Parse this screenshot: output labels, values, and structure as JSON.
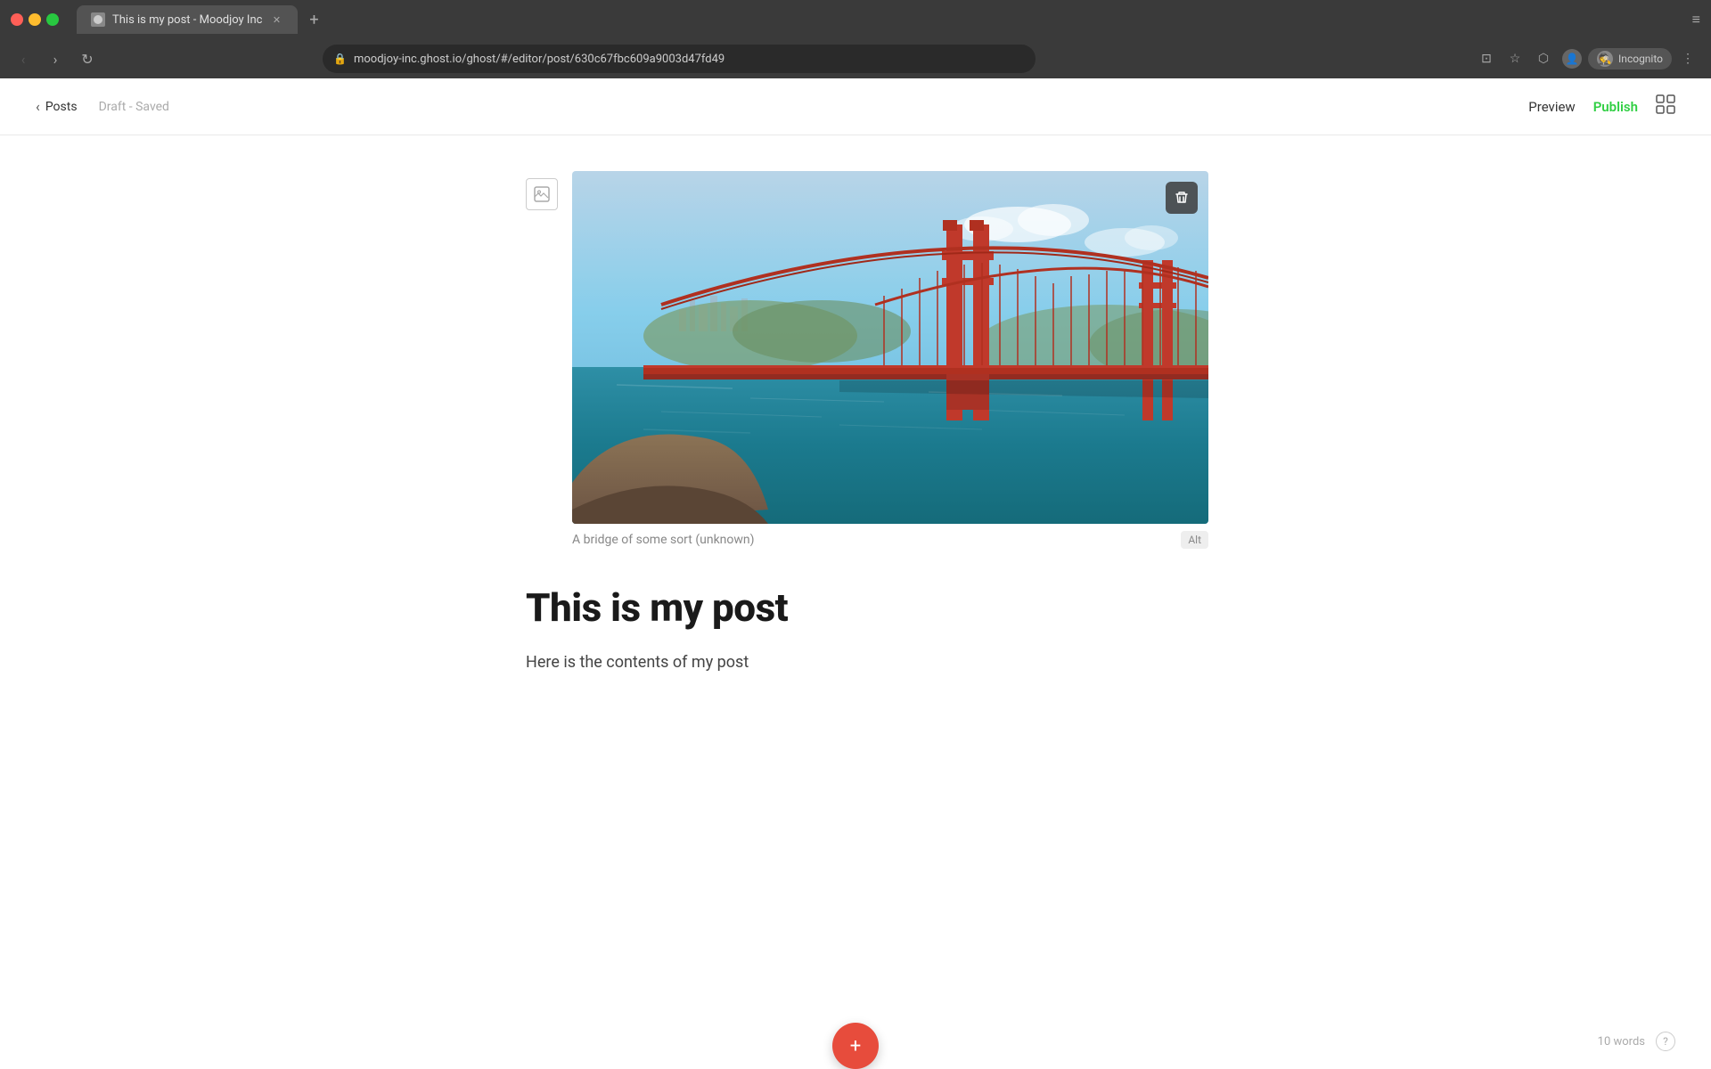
{
  "browser": {
    "tab_title": "This is my post - Moodjoy Inc",
    "url": "moodjoy-inc.ghost.io/ghost/#/editor/post/630c67fbc609a9003d47fd49",
    "incognito_label": "Incognito",
    "new_tab_label": "+",
    "tab_end_label": "≡"
  },
  "toolbar": {
    "back_label": "Posts",
    "draft_status": "Draft - Saved",
    "preview_label": "Preview",
    "publish_label": "Publish"
  },
  "post": {
    "image_caption": "A bridge of some sort (unknown)",
    "alt_badge": "Alt",
    "title": "This is my post",
    "body": "Here is the contents of my post"
  },
  "footer": {
    "word_count": "10 words",
    "help_label": "?"
  },
  "icons": {
    "back_arrow": "‹",
    "image_icon": "🖼",
    "delete_icon": "🗑",
    "settings_icon": "⊡",
    "fab_icon": "+"
  }
}
